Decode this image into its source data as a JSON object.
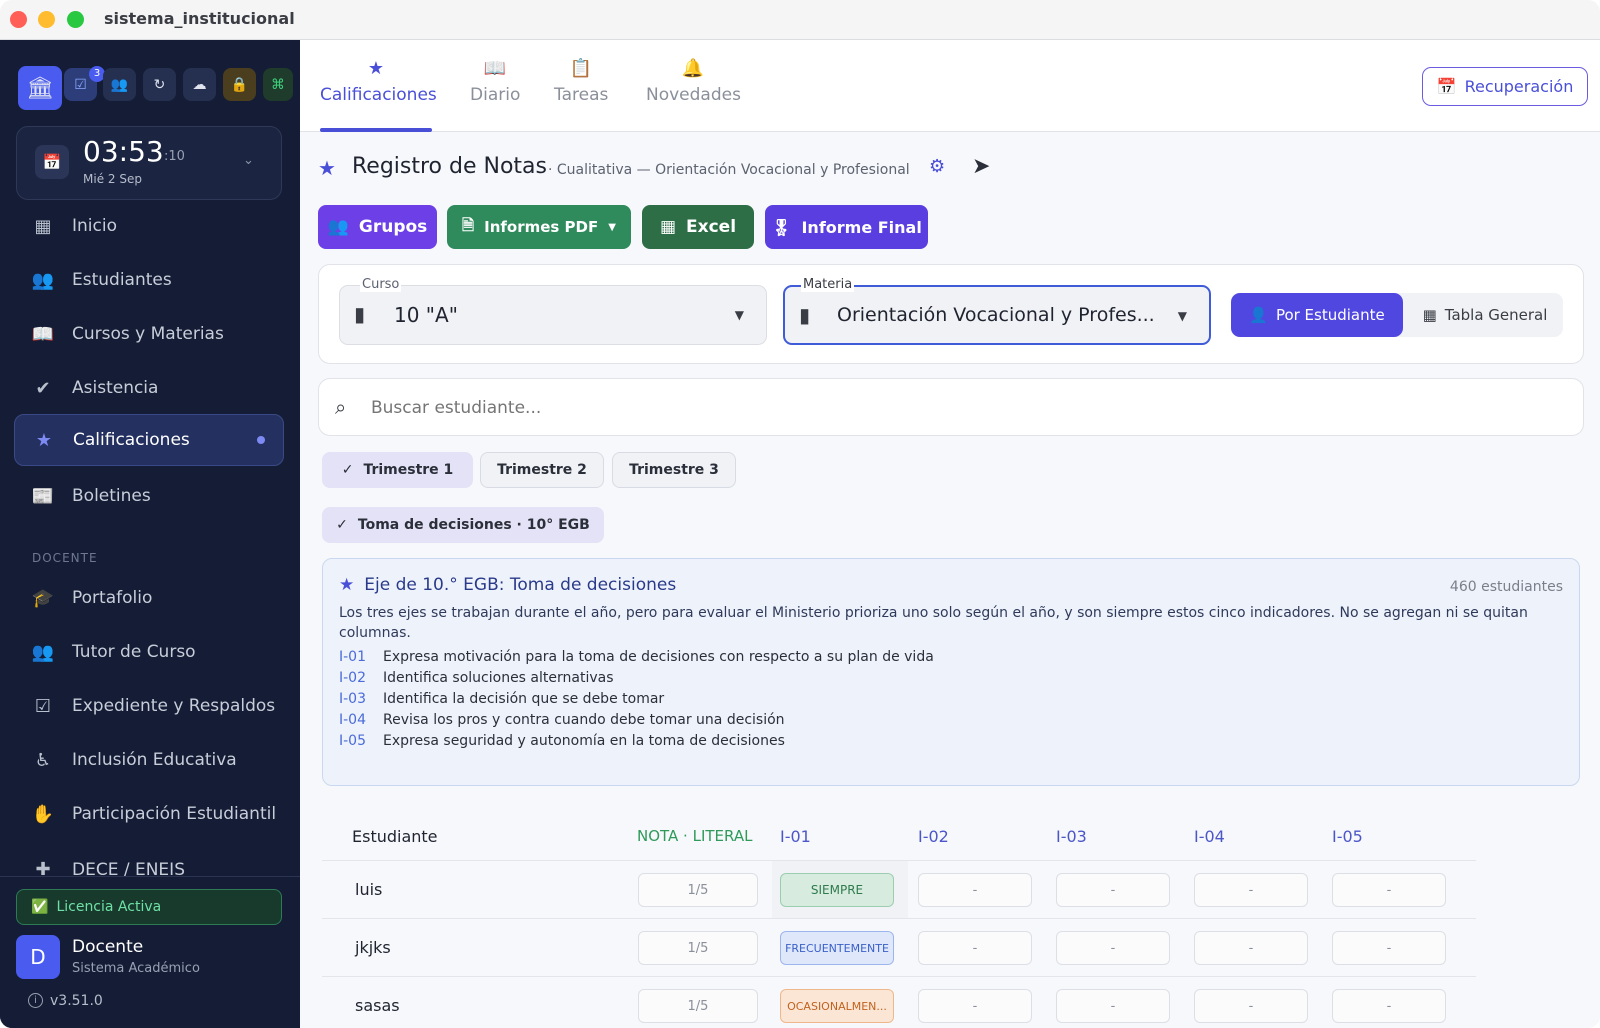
{
  "window": {
    "title": "sistema_institucional"
  },
  "toolbar": {
    "badge_count": "3"
  },
  "clock": {
    "time": "03:53",
    "seconds": ":10",
    "date": "Mié 2 Sep"
  },
  "nav": [
    {
      "label": "Inicio",
      "icon": "dashboard-icon"
    },
    {
      "label": "Estudiantes",
      "icon": "people-icon"
    },
    {
      "label": "Cursos y Materias",
      "icon": "book-icon"
    },
    {
      "label": "Asistencia",
      "icon": "person-check-icon"
    },
    {
      "label": "Calificaciones",
      "icon": "star-icon",
      "active": true
    },
    {
      "label": "Boletines",
      "icon": "newspaper-icon"
    }
  ],
  "section_label": "DOCENTE",
  "nav2": [
    {
      "label": "Portafolio",
      "icon": "school-icon"
    },
    {
      "label": "Tutor de Curso",
      "icon": "group-icon"
    },
    {
      "label": "Expediente y Respaldos",
      "icon": "checklist-icon"
    },
    {
      "label": "Inclusión Educativa",
      "icon": "accessibility-icon"
    },
    {
      "label": "Participación Estudiantil",
      "icon": "volunteer-icon"
    },
    {
      "label": "DECE / ENEIS",
      "icon": "health-icon"
    }
  ],
  "license": "Licencia Activa",
  "user": {
    "initial": "D",
    "name": "Docente",
    "role": "Sistema Académico"
  },
  "version": "v3.51.0",
  "tabs": [
    "Calificaciones",
    "Diario",
    "Tareas",
    "Novedades"
  ],
  "recovery_label": "Recuperación",
  "header": {
    "title": "Registro de Notas",
    "subtitle": "· Cualitativa — Orientación Vocacional y Profesional"
  },
  "actions": {
    "grupos": "Grupos",
    "pdf": "Informes PDF",
    "excel": "Excel",
    "final": "Informe Final"
  },
  "filters": {
    "curso_label": "Curso",
    "curso_value": "10 \"A\"",
    "materia_label": "Materia",
    "materia_value": "Orientación Vocacional y Profes...",
    "view1": "Por Estudiante",
    "view2": "Tabla General"
  },
  "search": {
    "placeholder": "Buscar estudiante..."
  },
  "terms": [
    "Trimestre 1",
    "Trimestre 2",
    "Trimestre 3"
  ],
  "axis_chip": "Toma de decisiones · 10° EGB",
  "axis": {
    "title": "Eje de 10.° EGB: Toma de decisiones",
    "count": "460 estudiantes",
    "description": "Los tres ejes se trabajan durante el año, pero para evaluar el Ministerio prioriza uno solo según el año, y son siempre estos cinco indicadores. No se agregan ni se quitan columnas.",
    "indicators": [
      {
        "code": "I-01",
        "text": "Expresa motivación para la toma de decisiones con respecto a su plan de vida"
      },
      {
        "code": "I-02",
        "text": "Identifica soluciones alternativas"
      },
      {
        "code": "I-03",
        "text": "Identifica la decisión que se debe tomar"
      },
      {
        "code": "I-04",
        "text": "Revisa los pros y contra cuando debe tomar una decisión"
      },
      {
        "code": "I-05",
        "text": "Expresa seguridad y autonomía en la toma de decisiones"
      }
    ]
  },
  "table": {
    "headers": {
      "student": "Estudiante",
      "grade": "NOTA · LITERAL",
      "i1": "I-01",
      "i2": "I-02",
      "i3": "I-03",
      "i4": "I-04",
      "i5": "I-05"
    },
    "rows": [
      {
        "name": "luis",
        "grade": "1/5",
        "i1": "SIEMPRE",
        "i2": "-",
        "i3": "-",
        "i4": "-",
        "i5": "-"
      },
      {
        "name": "jkjks",
        "grade": "1/5",
        "i1": "FRECUENTEMENTE",
        "i2": "-",
        "i3": "-",
        "i4": "-",
        "i5": "-"
      },
      {
        "name": "sasas",
        "grade": "1/5",
        "i1": "OCASIONALMEN...",
        "i2": "-",
        "i3": "-",
        "i4": "-",
        "i5": "-"
      }
    ]
  },
  "colors": {
    "accent": "#5b3ee0",
    "sidebar": "#141d35",
    "green": "#2f8a5c",
    "excel": "#2e6e46"
  }
}
